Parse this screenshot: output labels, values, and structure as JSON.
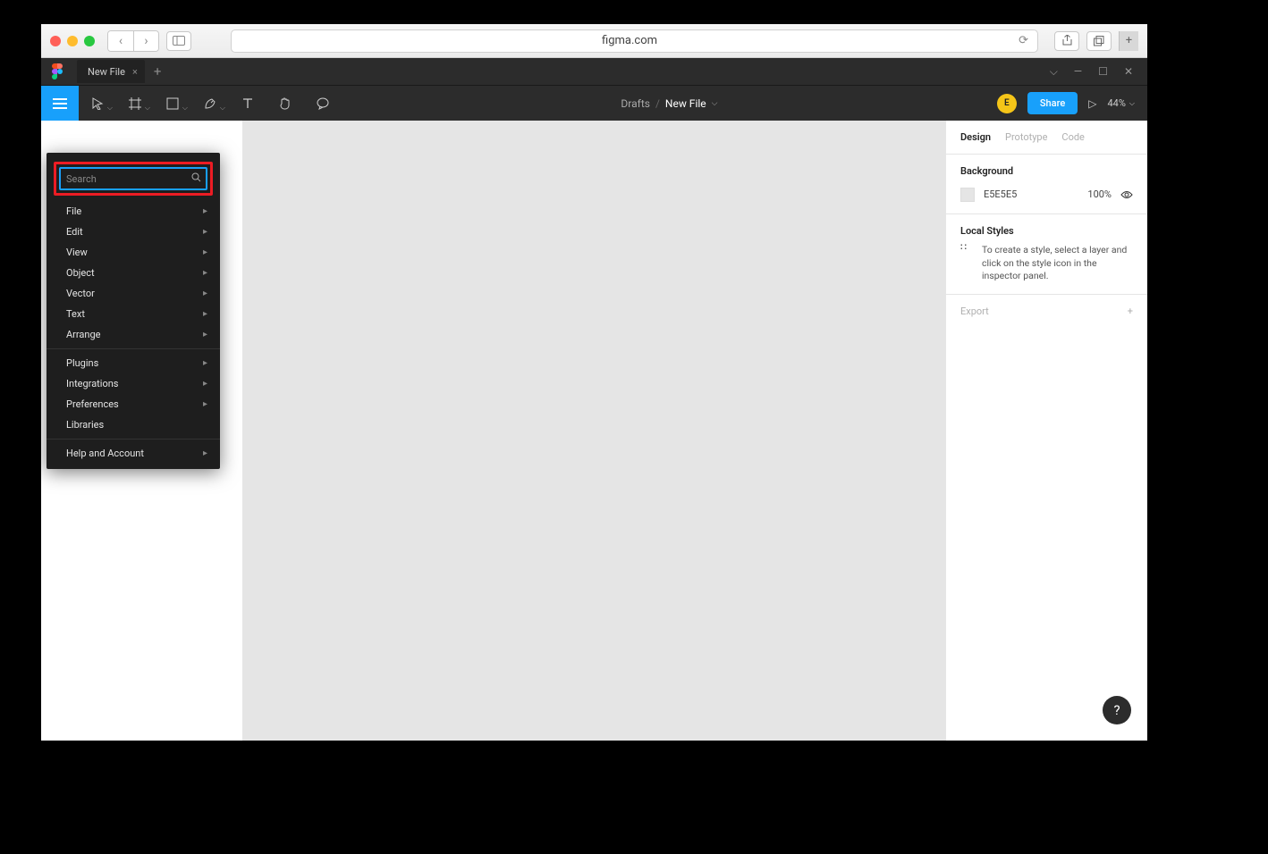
{
  "browser": {
    "url": "figma.com"
  },
  "tabbar": {
    "file_tab": "New File"
  },
  "breadcrumb": {
    "drafts": "Drafts",
    "file": "New File"
  },
  "toolbar": {
    "share_label": "Share",
    "zoom": "44%",
    "avatar_initial": "E"
  },
  "menu": {
    "search_placeholder": "Search",
    "group1": [
      {
        "label": "File"
      },
      {
        "label": "Edit"
      },
      {
        "label": "View"
      },
      {
        "label": "Object"
      },
      {
        "label": "Vector"
      },
      {
        "label": "Text"
      },
      {
        "label": "Arrange"
      }
    ],
    "group2": [
      {
        "label": "Plugins"
      },
      {
        "label": "Integrations"
      },
      {
        "label": "Preferences"
      },
      {
        "label": "Libraries",
        "has_sub": false
      }
    ],
    "group3": [
      {
        "label": "Help and Account"
      }
    ]
  },
  "right_panel": {
    "tabs": {
      "design": "Design",
      "prototype": "Prototype",
      "code": "Code"
    },
    "background": {
      "title": "Background",
      "hex": "E5E5E5",
      "opacity": "100%"
    },
    "local_styles": {
      "title": "Local Styles",
      "hint": "To create a style, select a layer and click on the style icon in the inspector panel."
    },
    "export": "Export"
  }
}
